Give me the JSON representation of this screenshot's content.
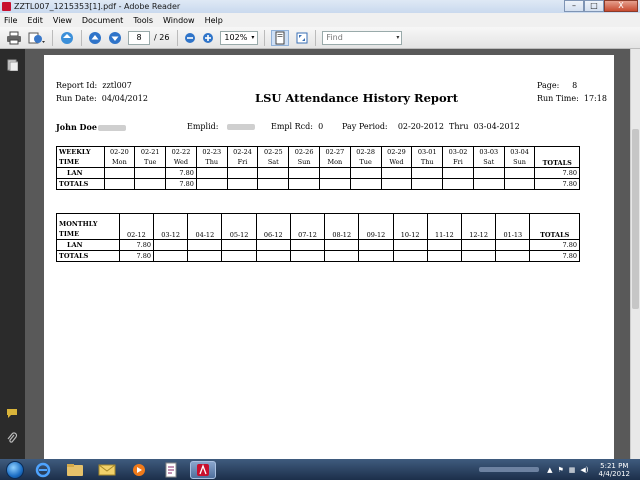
{
  "window": {
    "title": "ZZTL007_1215353[1].pdf - Adobe Reader",
    "minimize": "–",
    "maximize": "□",
    "close": "X"
  },
  "menu": [
    "File",
    "Edit",
    "View",
    "Document",
    "Tools",
    "Window",
    "Help"
  ],
  "toolbar": {
    "page_current": "8",
    "page_total": "/ 26",
    "zoom": "102%",
    "find_placeholder": "Find"
  },
  "report": {
    "report_id_label": "Report Id:",
    "report_id": "zztl007",
    "run_date_label": "Run Date:",
    "run_date": "04/04/2012",
    "title": "LSU Attendance History Report",
    "page_label": "Page:",
    "page": "8",
    "run_time_label": "Run Time:",
    "run_time": "17:18",
    "employee_name": "John Doe",
    "emplid_label": "Emplid:",
    "empl_rcd_label": "Empl Rcd:",
    "empl_rcd": "0",
    "pay_period_label": "Pay Period:",
    "pay_period_start": "02-20-2012",
    "pay_period_thru": "Thru",
    "pay_period_end": "03-04-2012"
  },
  "weekly": {
    "label1": "WEEKLY",
    "label2": "TIME",
    "dates": [
      "02-20",
      "02-21",
      "02-22",
      "02-23",
      "02-24",
      "02-25",
      "02-26",
      "02-27",
      "02-28",
      "02-29",
      "03-01",
      "03-02",
      "03-03",
      "03-04"
    ],
    "days": [
      "Mon",
      "Tue",
      "Wed",
      "Thu",
      "Fri",
      "Sat",
      "Sun",
      "Mon",
      "Tue",
      "Wed",
      "Thu",
      "Fri",
      "Sat",
      "Sun"
    ],
    "totals_header": "TOTALS",
    "rows": [
      {
        "label": "LAN",
        "values": [
          "",
          "",
          "7.80",
          "",
          "",
          "",
          "",
          "",
          "",
          "",
          "",
          "",
          "",
          ""
        ],
        "total": "7.80"
      },
      {
        "label": "TOTALS",
        "values": [
          "",
          "",
          "7.80",
          "",
          "",
          "",
          "",
          "",
          "",
          "",
          "",
          "",
          "",
          ""
        ],
        "total": "7.80"
      }
    ]
  },
  "monthly": {
    "label1": "MONTHLY",
    "label2": "TIME",
    "months": [
      "02-12",
      "03-12",
      "04-12",
      "05-12",
      "06-12",
      "07-12",
      "08-12",
      "09-12",
      "10-12",
      "11-12",
      "12-12",
      "01-13"
    ],
    "totals_header": "TOTALS",
    "rows": [
      {
        "label": "LAN",
        "values": [
          "7.80",
          "",
          "",
          "",
          "",
          "",
          "",
          "",
          "",
          "",
          "",
          ""
        ],
        "total": "7.80"
      },
      {
        "label": "TOTALS",
        "values": [
          "7.80",
          "",
          "",
          "",
          "",
          "",
          "",
          "",
          "",
          "",
          "",
          ""
        ],
        "total": "7.80"
      }
    ]
  },
  "taskbar": {
    "time": "5:21 PM",
    "date": "4/4/2012"
  }
}
